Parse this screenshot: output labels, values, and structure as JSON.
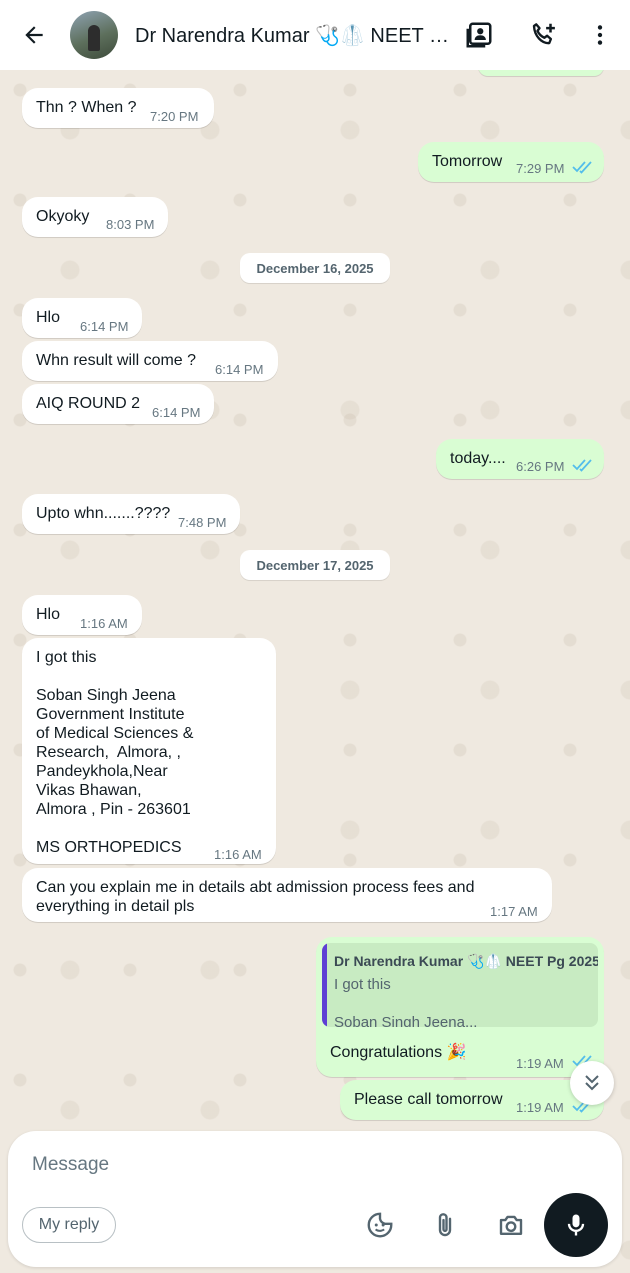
{
  "header": {
    "title": "Dr Narendra Kumar 🩺🥼 NEET Pg..."
  },
  "messages": {
    "m1": {
      "text": "Thn ? When ?",
      "time": "7:20 PM"
    },
    "m2": {
      "text": "Tomorrow",
      "time": "7:29 PM"
    },
    "m3": {
      "text": "Okyoky",
      "time": "8:03 PM"
    },
    "d1": "December 16, 2025",
    "m4": {
      "text": "Hlo",
      "time": "6:14 PM"
    },
    "m5": {
      "text": "Whn result will come ?",
      "time": "6:14 PM"
    },
    "m6": {
      "text": "AIQ ROUND 2",
      "time": "6:14 PM"
    },
    "m7": {
      "text": "today....",
      "time": "6:26 PM"
    },
    "m8": {
      "text": "Upto whn.......????",
      "time": "7:48 PM"
    },
    "d2": "December 17, 2025",
    "m9": {
      "text": "Hlo",
      "time": "1:16 AM"
    },
    "m10": {
      "text": "I got this\n\nSoban Singh Jeena\nGovernment Institute\nof Medical Sciences &\nResearch,  Almora, ,\nPandeykhola,Near\nVikas Bhawan,\nAlmora , Pin - 263601\n\nMS ORTHOPEDICS",
      "time": "1:16 AM"
    },
    "m11": {
      "text": "Can you explain me in details abt admission process fees and\neverything in detail pls",
      "time": "1:17 AM"
    },
    "m12": {
      "quote_author": "Dr Narendra Kumar 🩺🥼 NEET Pg 2025",
      "quote_line1": "I got this",
      "quote_line2": "Soban Singh Jeena...",
      "text": "Congratulations 🎉",
      "time": "1:19 AM"
    },
    "m13": {
      "text": "Please call tomorrow",
      "time": "1:19 AM"
    }
  },
  "composer": {
    "placeholder": "Message",
    "reply_chip": "My reply"
  },
  "icons": [
    "back-arrow-icon",
    "contact-card-icon",
    "add-call-icon",
    "more-vertical-icon",
    "chevron-double-down-icon",
    "sticker-icon",
    "attach-icon",
    "camera-icon",
    "mic-icon"
  ],
  "colors": {
    "incoming": "#ffffff",
    "outgoing": "#d9fdd3",
    "read_ticks": "#53bdeb",
    "quote_bar": "#5e3fd4"
  }
}
